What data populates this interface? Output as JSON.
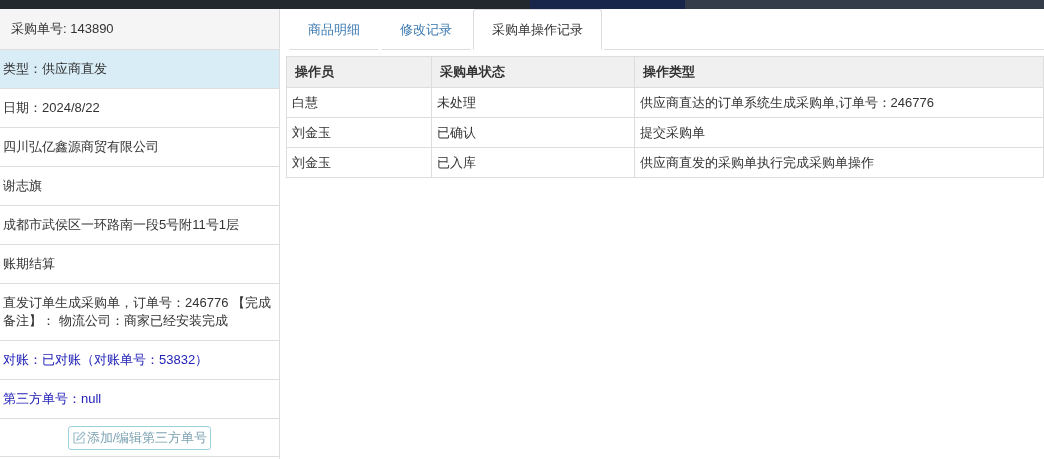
{
  "sidebar": {
    "title": "采购单号: 143890",
    "items": [
      {
        "text": "类型：供应商直发",
        "selected": true,
        "kind": "plain"
      },
      {
        "text": "日期：2024/8/22",
        "selected": false,
        "kind": "plain"
      },
      {
        "text": "四川弘亿鑫源商贸有限公司",
        "selected": false,
        "kind": "plain"
      },
      {
        "text": "谢志旗",
        "selected": false,
        "kind": "plain"
      },
      {
        "text": "成都市武侯区一环路南一段5号附11号1层",
        "selected": false,
        "kind": "plain"
      },
      {
        "text": "账期结算",
        "selected": false,
        "kind": "plain"
      },
      {
        "text": "直发订单生成采购单，订单号：246776 【完成备注】： 物流公司：商家已经安装完成",
        "selected": false,
        "kind": "plain"
      },
      {
        "text": "对账：已对账（对账单号：53832）",
        "selected": false,
        "kind": "accent"
      },
      {
        "text": "第三方单号：null",
        "selected": false,
        "kind": "accent"
      }
    ],
    "button": {
      "label": "添加/编辑第三方单号",
      "disabled": true
    }
  },
  "tabs": [
    {
      "label": "商品明细",
      "selected": false
    },
    {
      "label": "修改记录",
      "selected": false
    },
    {
      "label": "采购单操作记录",
      "selected": true
    }
  ],
  "table": {
    "columns": [
      "操作员",
      "采购单状态",
      "操作类型"
    ],
    "rows": [
      [
        "白慧",
        "未处理",
        "供应商直达的订单系统生成采购单,订单号：246776"
      ],
      [
        "刘金玉",
        "已确认",
        "提交采购单"
      ],
      [
        "刘金玉",
        "已入库",
        "供应商直发的采购单执行完成采购单操作"
      ]
    ]
  }
}
